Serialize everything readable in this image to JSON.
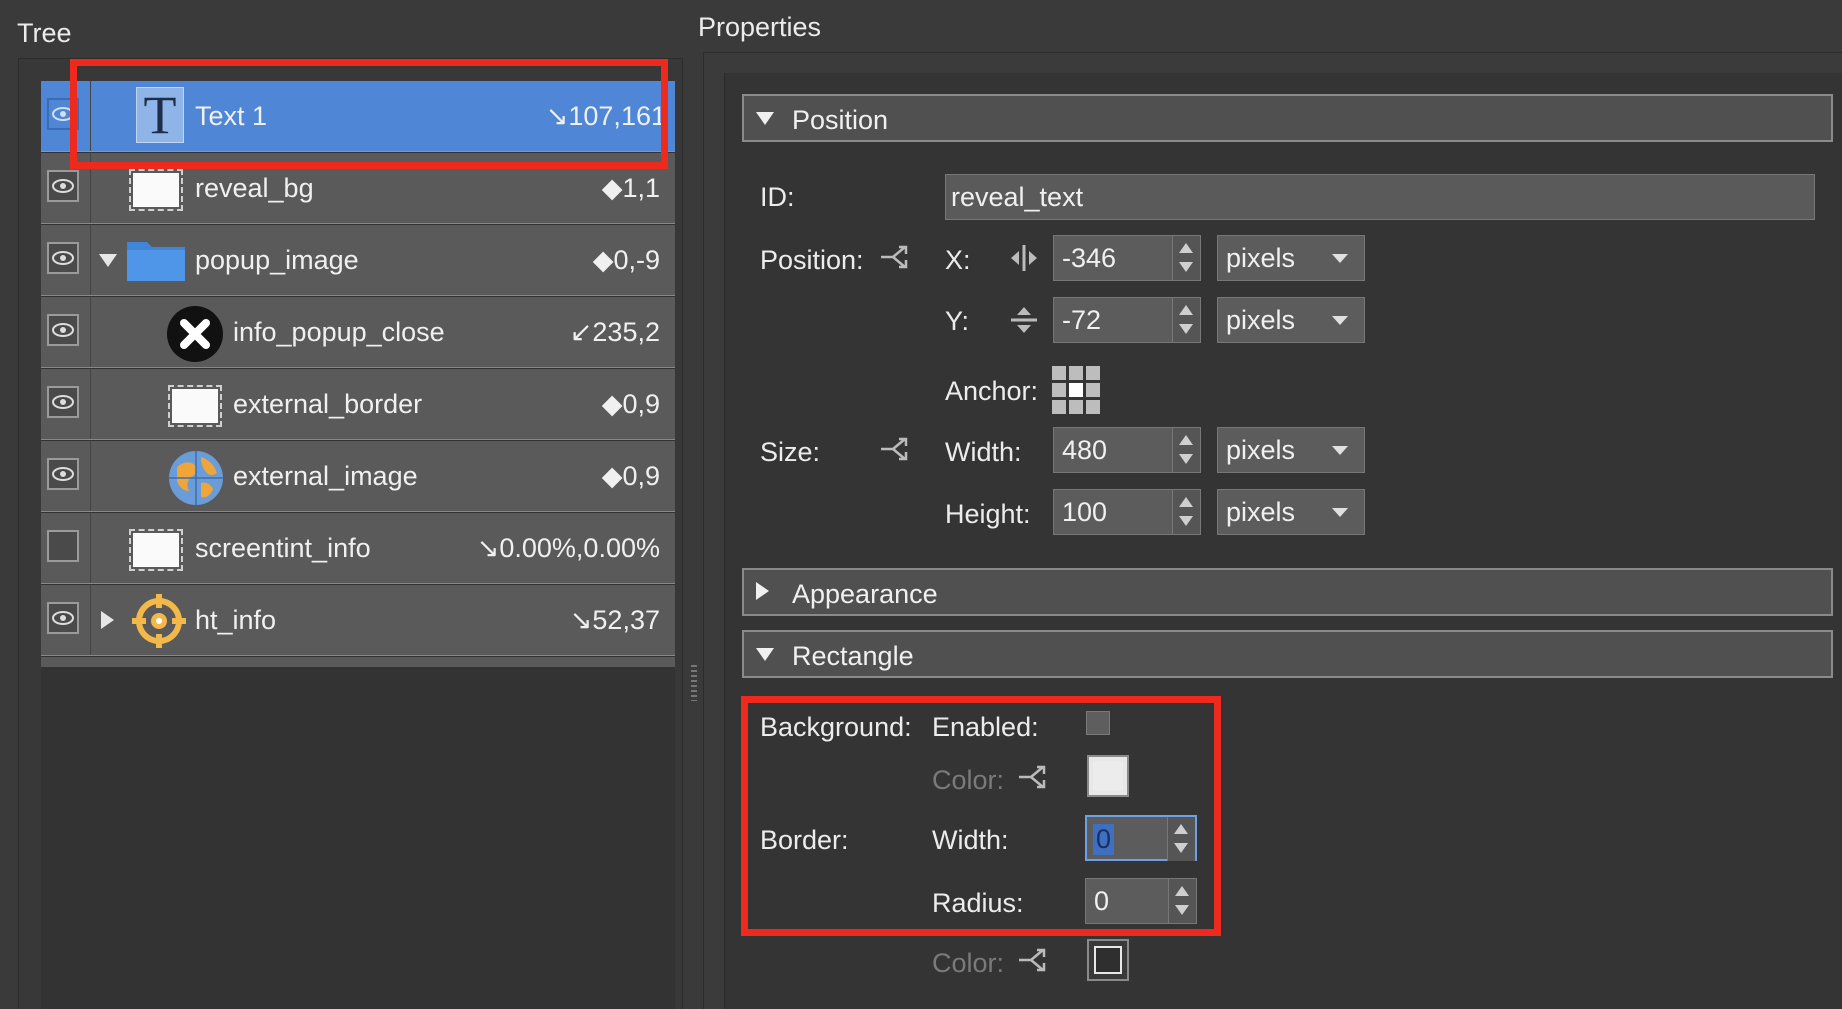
{
  "panels": {
    "tree_title": "Tree",
    "properties_title": "Properties"
  },
  "tree": {
    "items": [
      {
        "label": "Text 1",
        "value": "↘107,161",
        "icon": "text-icon",
        "visible": true,
        "selected": true
      },
      {
        "label": "reveal_bg",
        "value": "◆1,1",
        "icon": "rectangle-icon",
        "visible": true
      },
      {
        "label": "popup_image",
        "value": "◆0,-9",
        "icon": "folder-icon",
        "visible": true,
        "expanded": true
      },
      {
        "label": "info_popup_close",
        "value": "↙235,2",
        "icon": "close-icon",
        "visible": true
      },
      {
        "label": "external_border",
        "value": "◆0,9",
        "icon": "rectangle-icon",
        "visible": true
      },
      {
        "label": "external_image",
        "value": "◆0,9",
        "icon": "globe-icon",
        "visible": true
      },
      {
        "label": "screentint_info",
        "value": "↘0.00%,0.00%",
        "icon": "rectangle-icon",
        "visible": false
      },
      {
        "label": "ht_info",
        "value": "↘52,37",
        "icon": "target-icon",
        "visible": true,
        "expanded": false
      }
    ]
  },
  "properties": {
    "sections": {
      "position": "Position",
      "appearance": "Appearance",
      "rectangle": "Rectangle"
    },
    "id_label": "ID:",
    "id_value": "reveal_text",
    "position_label": "Position:",
    "x_label": "X:",
    "x_value": "-346",
    "x_unit": "pixels",
    "y_label": "Y:",
    "y_value": "-72",
    "y_unit": "pixels",
    "anchor_label": "Anchor:",
    "size_label": "Size:",
    "width_label": "Width:",
    "width_value": "480",
    "width_unit": "pixels",
    "height_label": "Height:",
    "height_value": "100",
    "height_unit": "pixels",
    "background_label": "Background:",
    "enabled_label": "Enabled:",
    "bg_color_label": "Color:",
    "border_label": "Border:",
    "border_width_label": "Width:",
    "border_width_value": "0",
    "radius_label": "Radius:",
    "radius_value": "0",
    "border_color_label": "Color:"
  },
  "colors": {
    "selection": "#4f87d6",
    "highlight": "#ee2a1e"
  }
}
